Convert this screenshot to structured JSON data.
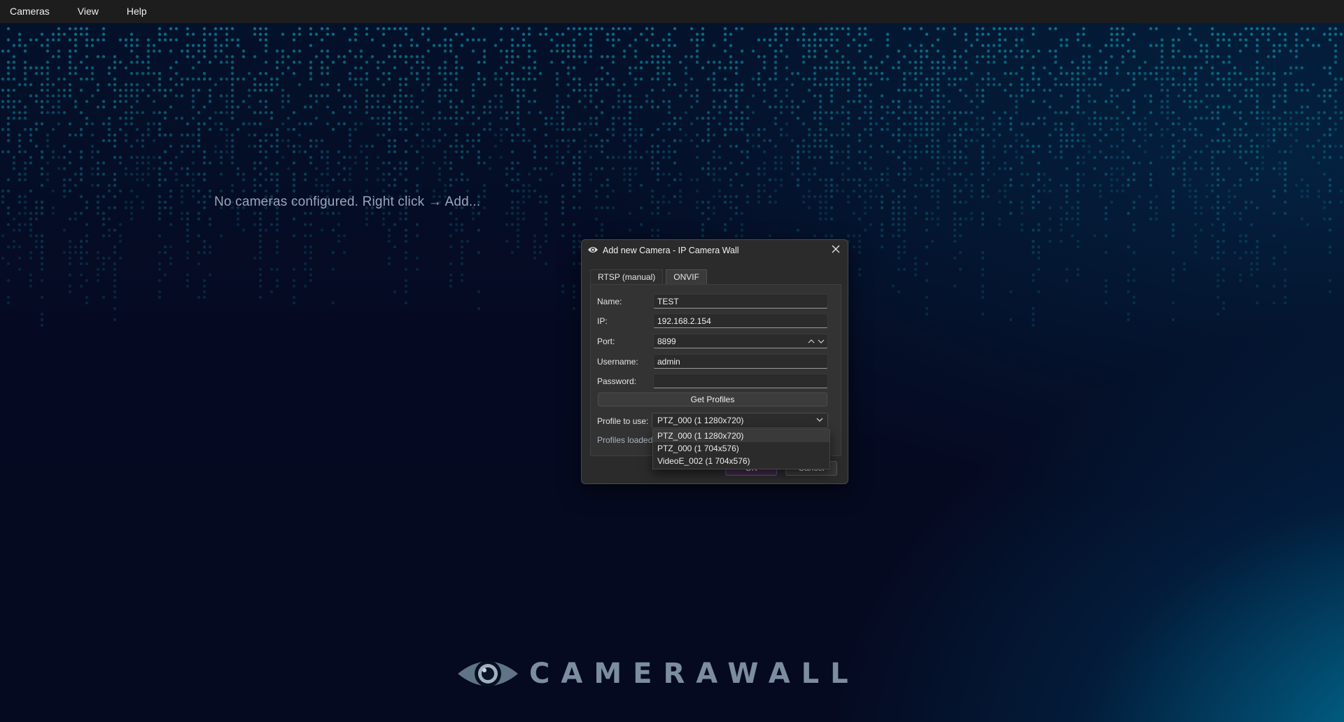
{
  "menubar": {
    "items": [
      "Cameras",
      "View",
      "Help"
    ]
  },
  "wall": {
    "empty_message": "No cameras configured. Right click → Add..."
  },
  "brand": {
    "logo_text": "CAMERAWALL"
  },
  "dialog": {
    "title": "Add new Camera - IP Camera Wall",
    "tabs": [
      {
        "label": "RTSP (manual)",
        "active": false
      },
      {
        "label": "ONVIF",
        "active": true
      }
    ],
    "fields": {
      "name": {
        "label": "Name:",
        "value": "TEST"
      },
      "ip": {
        "label": "IP:",
        "value": "192.168.2.154"
      },
      "port": {
        "label": "Port:",
        "value": "8899"
      },
      "username": {
        "label": "Username:",
        "value": "admin"
      },
      "password": {
        "label": "Password:",
        "value": ""
      }
    },
    "get_profiles_label": "Get Profiles",
    "profile": {
      "label": "Profile to use:",
      "selected": "PTZ_000 (1 1280x720)",
      "options": [
        "PTZ_000 (1 1280x720)",
        "PTZ_000 (1 704x576)",
        "VideoE_002 (1 704x576)"
      ]
    },
    "status_text": "Profiles loaded",
    "ok_label": "OK",
    "cancel_label": "Cancel"
  },
  "colors": {
    "background": "#050a20",
    "accent_teal": "#0aa0b5",
    "dialog_bg": "#2b2b2b",
    "ok_button": "#3f2b4a"
  },
  "icons": [
    "eye-icon",
    "close-icon",
    "chevron-up-icon",
    "chevron-down-icon",
    "camerawall-logo-icon"
  ]
}
